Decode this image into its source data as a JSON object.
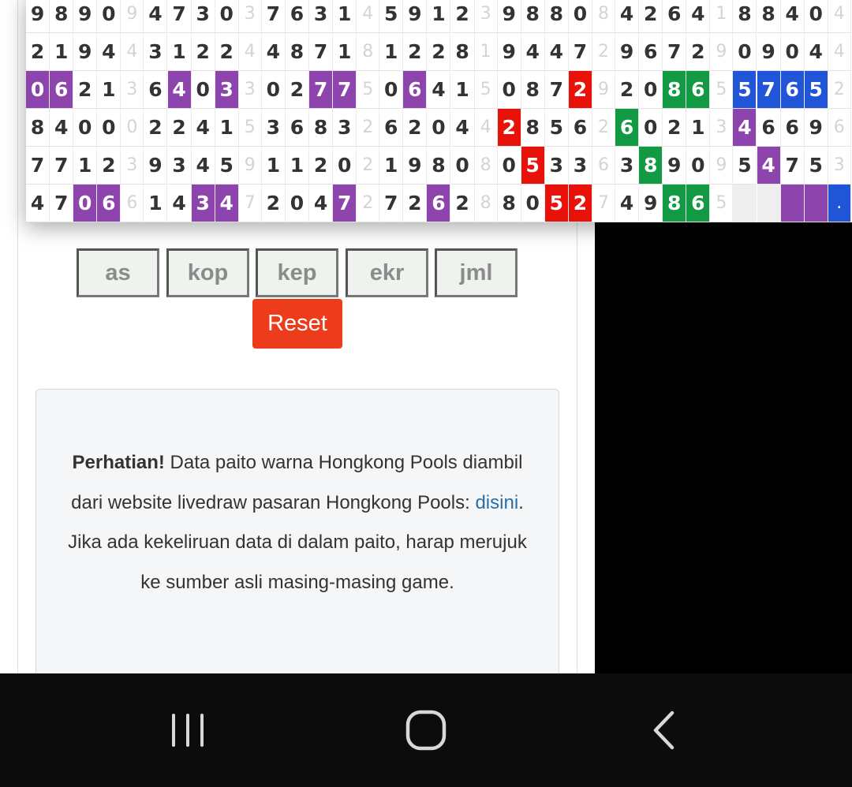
{
  "paito": {
    "rows": [
      [
        "9",
        "8",
        "9",
        "0",
        "9",
        "4",
        "7",
        "3",
        "0",
        "3",
        "7",
        "6",
        "3",
        "1",
        "4",
        "5",
        "9",
        "1",
        "2",
        "3",
        "9",
        "8",
        "8",
        "0",
        "8",
        "4",
        "2",
        "6",
        "4",
        "1",
        "8",
        "8",
        "4",
        "0",
        "4"
      ],
      [
        "2",
        "1",
        "9",
        "4",
        "4",
        "3",
        "1",
        "2",
        "2",
        "4",
        "4",
        "8",
        "7",
        "1",
        "8",
        "1",
        "2",
        "2",
        "8",
        "1",
        "9",
        "4",
        "4",
        "7",
        "2",
        "9",
        "6",
        "7",
        "2",
        "9",
        "0",
        "9",
        "0",
        "4",
        "4"
      ],
      [
        "0",
        "6",
        "2",
        "1",
        "3",
        "6",
        "4",
        "0",
        "3",
        "3",
        "0",
        "2",
        "7",
        "7",
        "5",
        "0",
        "6",
        "4",
        "1",
        "5",
        "0",
        "8",
        "7",
        "2",
        "9",
        "2",
        "0",
        "8",
        "6",
        "5",
        "5",
        "7",
        "6",
        "5",
        "2"
      ],
      [
        "8",
        "4",
        "0",
        "0",
        "0",
        "2",
        "2",
        "4",
        "1",
        "5",
        "3",
        "6",
        "8",
        "3",
        "2",
        "6",
        "2",
        "0",
        "4",
        "4",
        "2",
        "8",
        "5",
        "6",
        "2",
        "6",
        "0",
        "2",
        "1",
        "3",
        "4",
        "6",
        "6",
        "9",
        "6"
      ],
      [
        "7",
        "7",
        "1",
        "2",
        "3",
        "9",
        "3",
        "4",
        "5",
        "9",
        "1",
        "1",
        "2",
        "0",
        "2",
        "1",
        "9",
        "8",
        "0",
        "8",
        "0",
        "5",
        "3",
        "3",
        "6",
        "3",
        "8",
        "9",
        "0",
        "9",
        "5",
        "4",
        "7",
        "5",
        "3"
      ],
      [
        "4",
        "7",
        "0",
        "6",
        "6",
        "1",
        "4",
        "3",
        "4",
        "7",
        "2",
        "0",
        "4",
        "7",
        "2",
        "7",
        "2",
        "6",
        "2",
        "8",
        "8",
        "0",
        "5",
        "2",
        "7",
        "4",
        "9",
        "8",
        "6",
        "5",
        "",
        "",
        "",
        "",
        "."
      ]
    ],
    "highlights": [
      {
        "row": 2,
        "col": 0,
        "color": "purple"
      },
      {
        "row": 2,
        "col": 1,
        "color": "purple"
      },
      {
        "row": 2,
        "col": 6,
        "color": "purple"
      },
      {
        "row": 2,
        "col": 8,
        "color": "purple"
      },
      {
        "row": 2,
        "col": 12,
        "color": "purple"
      },
      {
        "row": 2,
        "col": 13,
        "color": "purple"
      },
      {
        "row": 2,
        "col": 16,
        "color": "purple"
      },
      {
        "row": 2,
        "col": 23,
        "color": "red"
      },
      {
        "row": 2,
        "col": 27,
        "color": "green"
      },
      {
        "row": 2,
        "col": 28,
        "color": "green"
      },
      {
        "row": 2,
        "col": 30,
        "color": "blue"
      },
      {
        "row": 2,
        "col": 31,
        "color": "blue"
      },
      {
        "row": 2,
        "col": 32,
        "color": "blue"
      },
      {
        "row": 2,
        "col": 33,
        "color": "blue"
      },
      {
        "row": 3,
        "col": 20,
        "color": "red"
      },
      {
        "row": 3,
        "col": 25,
        "color": "green"
      },
      {
        "row": 3,
        "col": 30,
        "color": "purple"
      },
      {
        "row": 4,
        "col": 21,
        "color": "red"
      },
      {
        "row": 4,
        "col": 26,
        "color": "green"
      },
      {
        "row": 4,
        "col": 31,
        "color": "purple"
      },
      {
        "row": 5,
        "col": 2,
        "color": "purple"
      },
      {
        "row": 5,
        "col": 3,
        "color": "purple"
      },
      {
        "row": 5,
        "col": 7,
        "color": "purple"
      },
      {
        "row": 5,
        "col": 8,
        "color": "purple"
      },
      {
        "row": 5,
        "col": 13,
        "color": "purple"
      },
      {
        "row": 5,
        "col": 17,
        "color": "purple"
      },
      {
        "row": 5,
        "col": 22,
        "color": "red"
      },
      {
        "row": 5,
        "col": 23,
        "color": "red"
      },
      {
        "row": 5,
        "col": 27,
        "color": "green"
      },
      {
        "row": 5,
        "col": 28,
        "color": "green"
      },
      {
        "row": 5,
        "col": 32,
        "color": "purple"
      },
      {
        "row": 5,
        "col": 33,
        "color": "purple"
      },
      {
        "row": 5,
        "col": 34,
        "color": "blue"
      }
    ],
    "colors": {
      "purple": "#8e44ad",
      "red": "#e8120b",
      "green": "#119944",
      "blue": "#1f55d6"
    }
  },
  "filters": [
    {
      "label": "as"
    },
    {
      "label": "kop"
    },
    {
      "label": "kep"
    },
    {
      "label": "ekr"
    },
    {
      "label": "jml"
    }
  ],
  "reset": {
    "label": "Reset"
  },
  "notice": {
    "bold": "Perhatian!",
    "text1": " Data paito warna Hongkong Pools diambil dari website livedraw pasaran Hongkong Pools: ",
    "link": "disini",
    "text2": ". Jika ada kekeliruan data di dalam paito, harap merujuk ke sumber asli masing-masing game."
  },
  "navbar": {
    "recent_icon": "recent-apps-icon",
    "home_icon": "home-icon",
    "back_icon": "back-icon"
  }
}
